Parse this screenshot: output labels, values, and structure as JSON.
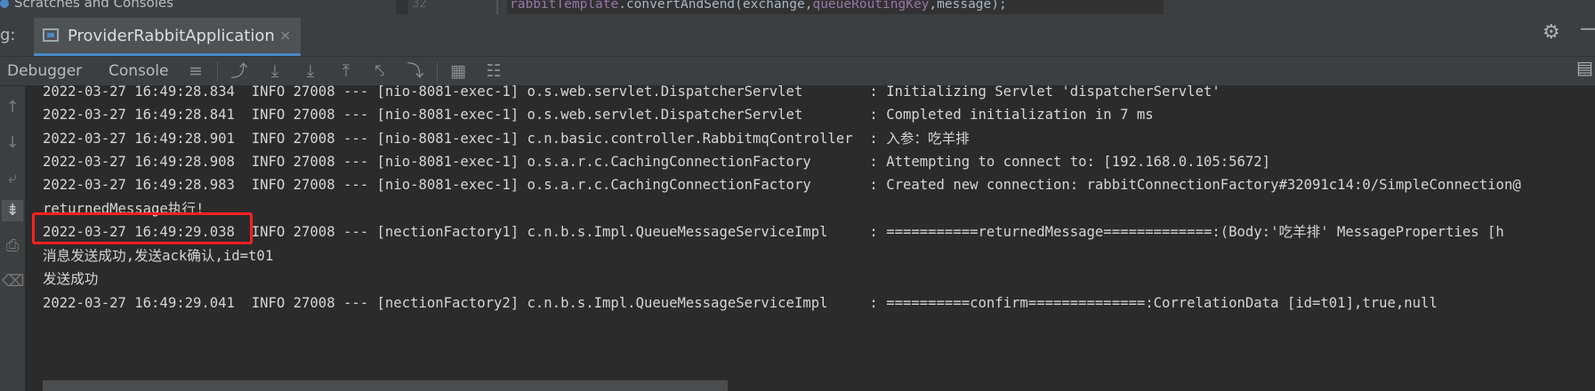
{
  "editor_strip": {
    "scratches_label": "Scratches and Consoles",
    "line_number": "32",
    "code": {
      "receiver": "rabbitTemplate",
      "call": ".convertAndSend(exchange,",
      "field": "queueRoutingKey",
      "rest": ",message);"
    }
  },
  "run_bar": {
    "label": "g:",
    "tab_title": "ProviderRabbitApplication",
    "close_glyph": "×",
    "gear_glyph": "⚙",
    "minimize_glyph": "—"
  },
  "toolbar": {
    "tabs": [
      "Debugger",
      "Console"
    ]
  },
  "console_lines": [
    "2022-03-27 16:49:28.834  INFO 27008 --- [nio-8081-exec-1] o.s.web.servlet.DispatcherServlet        : Initializing Servlet 'dispatcherServlet'",
    "2022-03-27 16:49:28.841  INFO 27008 --- [nio-8081-exec-1] o.s.web.servlet.DispatcherServlet        : Completed initialization in 7 ms",
    "2022-03-27 16:49:28.901  INFO 27008 --- [nio-8081-exec-1] c.n.basic.controller.RabbitmqController  : 入参：吃羊排",
    "2022-03-27 16:49:28.908  INFO 27008 --- [nio-8081-exec-1] o.s.a.r.c.CachingConnectionFactory       : Attempting to connect to: [192.168.0.105:5672]",
    "2022-03-27 16:49:28.983  INFO 27008 --- [nio-8081-exec-1] o.s.a.r.c.CachingConnectionFactory       : Created new connection: rabbitConnectionFactory#32091c14:0/SimpleConnection@",
    "returnedMessage执行!",
    "2022-03-27 16:49:29.038  INFO 27008 --- [nectionFactory1] c.n.b.s.Impl.QueueMessageServiceImpl     : ===========returnedMessage=============:(Body:'吃羊排' MessageProperties [h",
    "消息发送成功,发送ack确认,id=t01",
    "发送成功",
    "2022-03-27 16:49:29.041  INFO 27008 --- [nectionFactory2] c.n.b.s.Impl.QueueMessageServiceImpl     : ==========confirm==============:CorrelationData [id=t01],true,null"
  ]
}
